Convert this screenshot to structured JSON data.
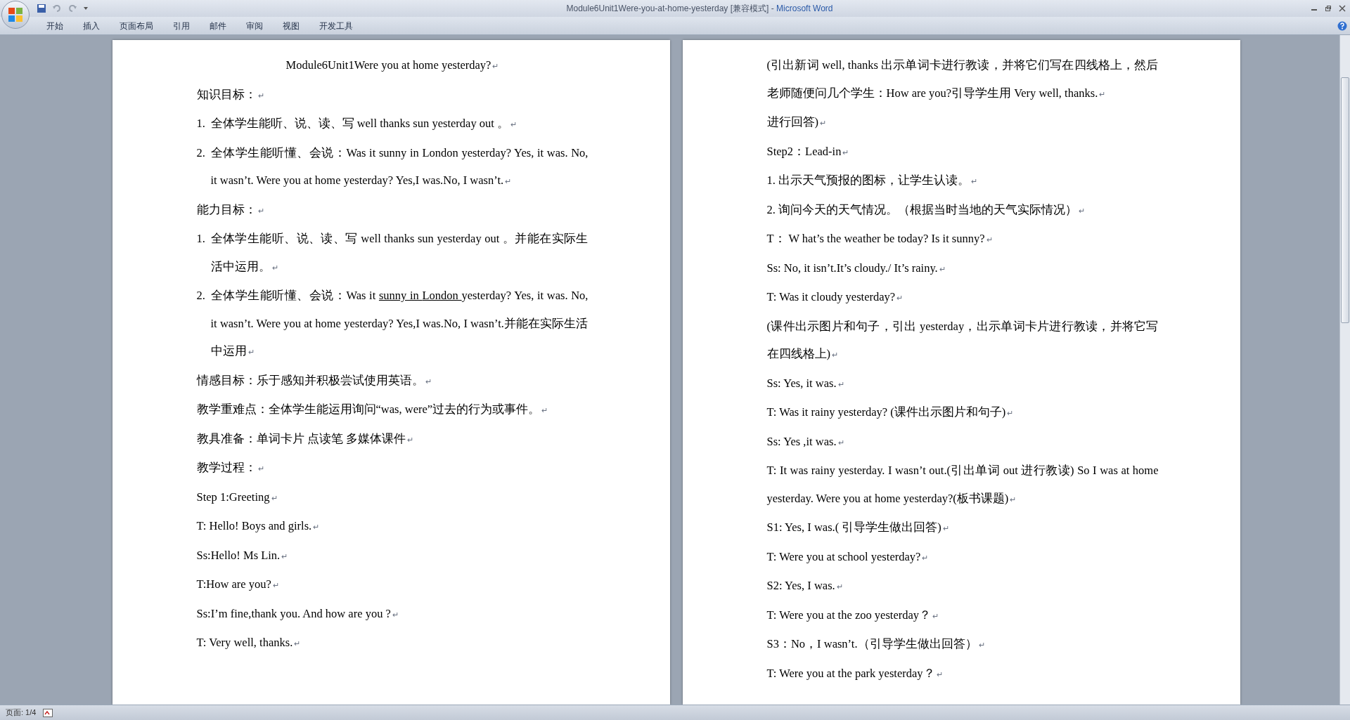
{
  "window": {
    "document": "Module6Unit1Were-you-at-home-yesterday [兼容模式]",
    "separator": " - ",
    "app": "Microsoft Word"
  },
  "ribbon_tabs": [
    {
      "label": "开始",
      "selected": false
    },
    {
      "label": "插入",
      "selected": false
    },
    {
      "label": "页面布局",
      "selected": false
    },
    {
      "label": "引用",
      "selected": false
    },
    {
      "label": "邮件",
      "selected": false
    },
    {
      "label": "审阅",
      "selected": false
    },
    {
      "label": "视图",
      "selected": false
    },
    {
      "label": "开发工具",
      "selected": false
    }
  ],
  "pages": [
    {
      "paragraphs": [
        {
          "kind": "title",
          "text": "Module6Unit1Were you at home yesterday?",
          "end_mark": "↵"
        },
        {
          "kind": "plain",
          "text": "知识目标：",
          "end_mark": "↵"
        },
        {
          "kind": "list",
          "number": "1.",
          "text": "全体学生能听、说、读、写 well thanks sun yesterday out 。",
          "end_mark": "↵"
        },
        {
          "kind": "list",
          "number": "2.",
          "text": "全体学生能听懂、会说：Was it sunny in London yesterday? Yes, it was. No, it wasn’t. Were you at home yesterday? Yes,I was.No, I wasn’t.",
          "end_mark": "↵"
        },
        {
          "kind": "plain",
          "text": "能力目标：",
          "end_mark": "↵"
        },
        {
          "kind": "list",
          "number": "1.",
          "text": "全体学生能听、说、读、写 well thanks sun yesterday out 。并能在实际生活中运用。",
          "end_mark": "↵"
        },
        {
          "kind": "list",
          "number": "2.",
          "runs": [
            {
              "text": "全体学生能听懂、会说：Was it ",
              "underline": false
            },
            {
              "text": "sunny in ",
              "underline": true
            },
            {
              "text": "London ",
              "underline": true
            },
            {
              "text": "yesterday? Yes, it was. No, it wasn’t. Were you at home yesterday? Yes,I was.No, I wasn’t.并能在实际生活中运用",
              "underline": false
            }
          ],
          "end_mark": "↵"
        },
        {
          "kind": "plain",
          "text": "情感目标：乐于感知并积极尝试使用英语。",
          "end_mark": "↵"
        },
        {
          "kind": "plain",
          "text": "教学重难点：全体学生能运用询问“was, were”过去的行为或事件。",
          "end_mark": "↵"
        },
        {
          "kind": "plain",
          "text": "教具准备：单词卡片 点读笔 多媒体课件",
          "end_mark": "↵"
        },
        {
          "kind": "plain",
          "text": "教学过程：",
          "end_mark": "↵"
        },
        {
          "kind": "plain",
          "text": "Step 1:Greeting",
          "end_mark": "↵"
        },
        {
          "kind": "plain",
          "text": "T: Hello! Boys and girls.",
          "end_mark": "↵"
        },
        {
          "kind": "plain",
          "text": "Ss:Hello! Ms Lin.",
          "end_mark": "↵"
        },
        {
          "kind": "plain",
          "text": "T:How are you?",
          "end_mark": "↵"
        },
        {
          "kind": "plain",
          "text": "Ss:I’m fine,thank you. And how are you ?",
          "end_mark": "↵"
        },
        {
          "kind": "plain",
          "text": "T: Very well, thanks.",
          "end_mark": "↵"
        }
      ]
    },
    {
      "paragraphs": [
        {
          "kind": "plain",
          "text": "(引出新词 well, thanks 出示单词卡进行教读，并将它们写在四线格上，然后老师随便问几个学生：How are you?引导学生用 Very well, thanks.",
          "end_mark": "↵"
        },
        {
          "kind": "plain",
          "text": "进行回答)",
          "end_mark": "↵"
        },
        {
          "kind": "plain",
          "text": "Step2：Lead-in",
          "end_mark": "↵"
        },
        {
          "kind": "plain",
          "text": "1. 出示天气预报的图标，让学生认读。",
          "end_mark": "↵"
        },
        {
          "kind": "plain",
          "text": "2. 询问今天的天气情况。（根据当时当地的天气实际情况）",
          "end_mark": "↵"
        },
        {
          "kind": "plain",
          "text": "T： W hat’s the weather be today? Is it sunny?",
          "end_mark": "↵"
        },
        {
          "kind": "plain",
          "text": "Ss: No, it isn’t.It’s cloudy./ It’s rainy.",
          "end_mark": "↵"
        },
        {
          "kind": "plain",
          "text": "T: Was it cloudy yesterday?",
          "end_mark": "↵"
        },
        {
          "kind": "plain",
          "text": "(课件出示图片和句子，引出 yesterday，出示单词卡片进行教读，并将它写在四线格上)",
          "end_mark": "↵"
        },
        {
          "kind": "plain",
          "text": "Ss: Yes, it was.",
          "end_mark": "↵"
        },
        {
          "kind": "plain",
          "text": "T: Was it rainy yesterday? (课件出示图片和句子)",
          "end_mark": "↵"
        },
        {
          "kind": "plain",
          "text": "Ss: Yes ,it was.",
          "end_mark": "↵"
        },
        {
          "kind": "plain",
          "text": "T: It was rainy yesterday. I wasn’t out.(引出单词 out 进行教读) So I was at home yesterday. Were you at home yesterday?(板书课题)",
          "end_mark": "↵"
        },
        {
          "kind": "plain",
          "text": "S1: Yes, I was.( 引导学生做出回答)",
          "end_mark": "↵"
        },
        {
          "kind": "plain",
          "text": "T: Were you at school yesterday?",
          "end_mark": "↵"
        },
        {
          "kind": "plain",
          "text": "S2: Yes, I was.",
          "end_mark": "↵"
        },
        {
          "kind": "plain",
          "text": "T: Were you at the zoo yesterday？",
          "end_mark": "↵"
        },
        {
          "kind": "plain",
          "text": "S3：No，I wasn’t.（引导学生做出回答）",
          "end_mark": "↵"
        },
        {
          "kind": "plain",
          "text": "T: Were you at the park yesterday？",
          "end_mark": "↵"
        }
      ]
    }
  ],
  "status_bar": {
    "page": "页面: 1/4"
  }
}
